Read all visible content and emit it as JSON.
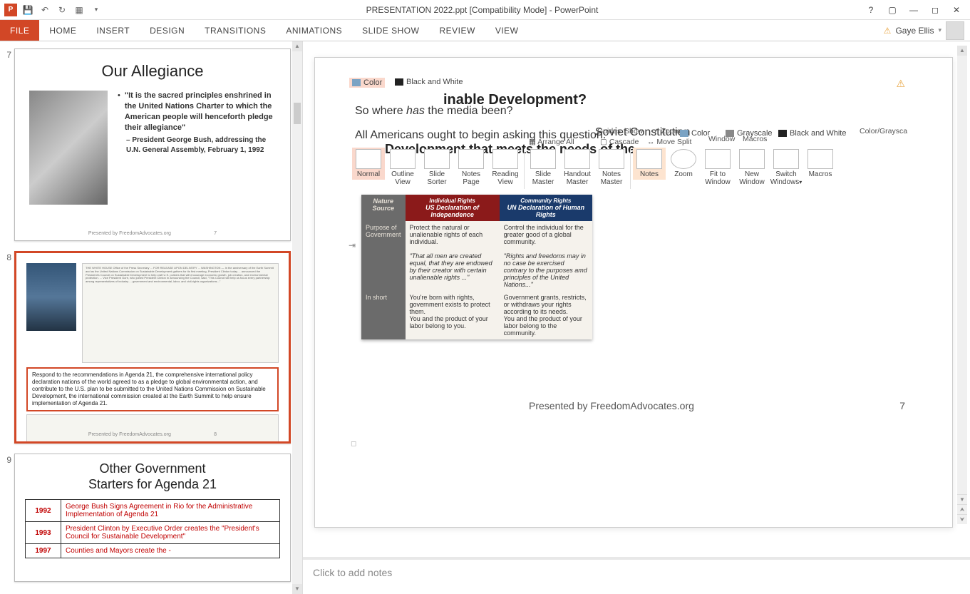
{
  "titlebar": {
    "app_badge": "P",
    "title": "PRESENTATION 2022.ppt [Compatibility Mode] - PowerPoint"
  },
  "ribbon": {
    "tabs": [
      "FILE",
      "HOME",
      "INSERT",
      "DESIGN",
      "TRANSITIONS",
      "ANIMATIONS",
      "SLIDE SHOW",
      "REVIEW",
      "VIEW"
    ],
    "user": "Gaye Ellis"
  },
  "thumbs": {
    "s7": {
      "num": "7",
      "title": "Our Allegiance",
      "quote": "\"It is the sacred principles enshrined in the United Nations Charter to which the American people will henceforth pledge their allegiance\"",
      "attr": "– President George Bush, addressing the U.N. General Assembly, February 1, 1992",
      "footer": "Presented by FreedomAdvocates.org",
      "page": "7"
    },
    "s8": {
      "num": "8",
      "callout": "Respond to the recommendations in Agenda 21, the comprehensive international policy declaration nations of the world agreed to as a pledge to global environmental action, and contribute to the U.S. plan to be submitted to the United Nations Commission on Sustainable Development, the international commission created at the Earth Summit to help ensure implementation of Agenda 21.",
      "footer": "Presented by FreedomAdvocates.org",
      "page": "8"
    },
    "s9": {
      "num": "9",
      "title_a": "Other Government",
      "title_b": "Starters for Agenda 21",
      "rows": [
        {
          "year": "1992",
          "desc": "George Bush Signs Agreement  in Rio for the Administrative Implementation of Agenda 21"
        },
        {
          "year": "1993",
          "desc": "President Clinton by Executive Order creates the \"President's Council for Sustainable Development\""
        },
        {
          "year": "1997",
          "desc": "Counties and Mayors create the -"
        }
      ]
    }
  },
  "ghosts": {
    "color": "Color",
    "bw": "Black and White",
    "grayscale": "Grayscale",
    "color_gray": "Color/Graysca",
    "guides": "Guides",
    "show": "Show",
    "zoom": "Zoom",
    "arrange": "Arrange All",
    "cascade": "Cascade",
    "move_split": "Move Split",
    "window": "Window",
    "macros": "Macros",
    "soviet": "Soviet Constitution",
    "dev_clip": "inable Development?",
    "dev_line": "Development that meets the needs of the"
  },
  "slide": {
    "line1_a": "So where ",
    "line1_em": "has",
    "line1_b": " the media been?",
    "line2": "All Americans ought to begin asking this question.",
    "presented": "Presented by FreedomAdvocates.org",
    "page": "7"
  },
  "view_btns": {
    "normal": "Normal",
    "outline": "Outline View",
    "sorter": "Slide Sorter",
    "notes_page": "Notes Page",
    "reading": "Reading View",
    "slide_master": "Slide Master",
    "handout": "Handout Master",
    "notes_master": "Notes Master",
    "notes": "Notes",
    "zoom": "Zoom",
    "fit": "Fit to Window",
    "new_win": "New Window",
    "switch": "Switch Windows",
    "macros": "Macros"
  },
  "cmp": {
    "h_nature": "Nature Source",
    "h_indiv": "Individual Rights",
    "h_indiv2": "US Declaration of Independence",
    "h_comm": "Community Rights",
    "h_comm2": "UN Declaration of Human Rights",
    "r1_l": "Purpose of Government",
    "r1_m": "Protect the natural or unalienable rights of each individual.",
    "r1_m2": "\"That all men are created equal, that they are endowed by their creator with certain unalienable rights ...\"",
    "r1_r": "Control the individual for the greater good of a global community.",
    "r1_r2": "\"Rights and freedoms may in no case be exercised contrary to the purposes amd principles of the United Nations...\"",
    "r2_l": "In short",
    "r2_m": "You're born with rights, government exists to protect them.",
    "r2_m2": "You and the product of your labor belong to you.",
    "r2_r": "Government grants, restricts, or withdraws your rights according to its needs.",
    "r2_r2": "You and the product of your labor belong to the community."
  },
  "notes": {
    "placeholder": "Click to add notes"
  }
}
